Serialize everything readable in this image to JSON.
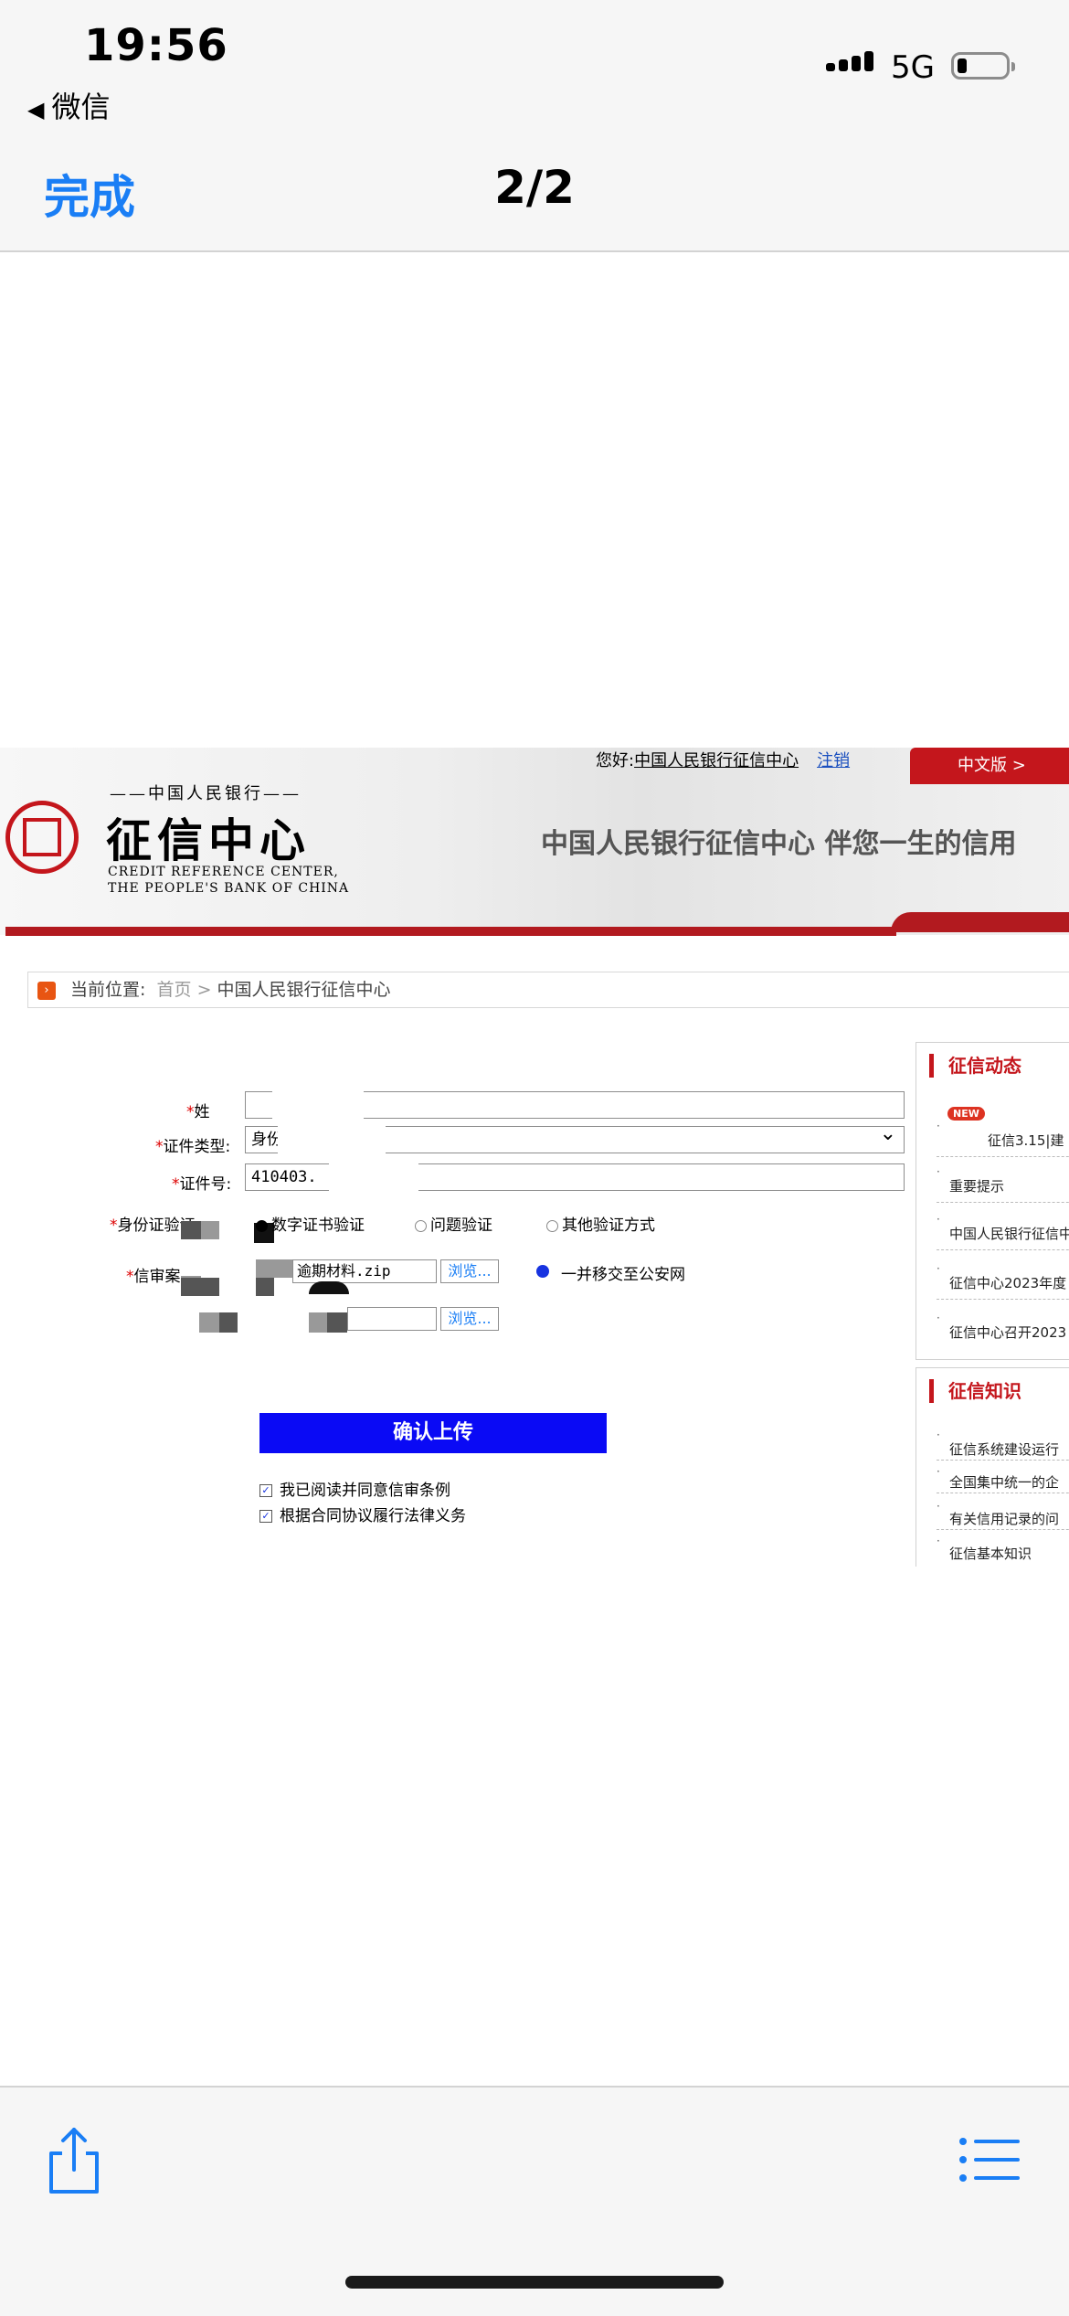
{
  "status_bar": {
    "time": "19:56",
    "back_app": "微信",
    "network": "5G",
    "battery_level_fraction": 0.2
  },
  "nav": {
    "done_label": "完成",
    "pager": "2/2"
  },
  "web_page": {
    "header": {
      "greeting_prefix": "您好:",
      "user": "中国人民银行征信中心",
      "logout": "注销",
      "lang_tab": "中文版  >",
      "org_small": "——中国人民银行——",
      "title": "征信中心",
      "english_line1": "CREDIT REFERENCE CENTER,",
      "english_line2": "THE PEOPLE'S BANK OF CHINA",
      "slogan": "中国人民银行征信中心  伴您一生的信用"
    },
    "breadcrumb": {
      "label": "当前位置:",
      "home": "首页",
      "separator": ">",
      "current": "中国人民银行征信中心"
    },
    "form": {
      "name_label": "姓",
      "name_value": "",
      "id_type_label": "证件类型:",
      "id_type_value": "身份",
      "id_no_label": "证件号:",
      "id_no_value": "410403.",
      "verify_label": "身份证验证",
      "verify_options": [
        "数字证书验证",
        "问题验证",
        "其他验证方式"
      ],
      "letter_label": "信审案",
      "file1": "逾期材料.zip",
      "browse": "浏览...",
      "police_option": "一并移交至公安网",
      "submit": "确认上传",
      "checks": [
        "我已阅读并同意信审条例",
        "根据合同协议履行法律义务"
      ]
    },
    "sidebar_news": {
      "title": "征信动态",
      "badge": "NEW",
      "items": [
        "征信3.15|建",
        "重要提示",
        "中国人民银行征信中",
        "征信中心2023年度",
        "征信中心召开2023"
      ]
    },
    "sidebar_knowledge": {
      "title": "征信知识",
      "items": [
        "征信系统建设运行",
        "全国集中统一的企",
        "有关信用记录的问",
        "征信基本知识"
      ]
    }
  },
  "toolbar": {
    "share_icon": "share-icon",
    "list_icon": "list-icon"
  }
}
